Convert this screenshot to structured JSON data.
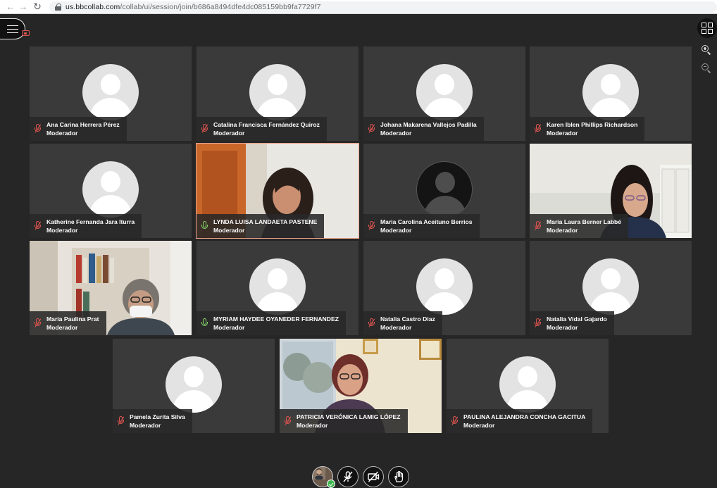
{
  "browser": {
    "url_host": "us.bbcollab.com",
    "url_path": "/collab/ui/session/join/b686a8494dfe4dc085159bb9fa7729f7"
  },
  "tiles": [
    {
      "name": "Ana Carina Herrera Pérez",
      "role": "Moderador",
      "mic": "muted",
      "media": "avatar"
    },
    {
      "name": "Catalina Francisca Fernández Quiroz",
      "role": "Moderador",
      "mic": "muted",
      "media": "avatar"
    },
    {
      "name": "Johana Makarena Vallejos Padilla",
      "role": "Moderador",
      "mic": "muted",
      "media": "avatar"
    },
    {
      "name": "Karen Iblen Phillips Richardson",
      "role": "Moderador",
      "mic": "muted",
      "media": "avatar"
    },
    {
      "name": "Katherine Fernanda Jara Iturra",
      "role": "Moderador",
      "mic": "muted",
      "media": "avatar"
    },
    {
      "name": "LYNDA LUISA LANDAETA PASTENE",
      "role": "Moderador",
      "mic": "on",
      "media": "video",
      "speaking": true
    },
    {
      "name": "Maria Carolina Aceituno Berrios",
      "role": "Moderador",
      "mic": "muted",
      "media": "avatar-dark"
    },
    {
      "name": "Maria Laura Berner Labbé",
      "role": "Moderador",
      "mic": "muted",
      "media": "video"
    },
    {
      "name": "Maria Paulina Prat",
      "role": "Moderador",
      "mic": "muted",
      "media": "video"
    },
    {
      "name": "MYRIAM HAYDEE OYANEDER FERNANDEZ",
      "role": "Moderador",
      "mic": "on",
      "media": "avatar"
    },
    {
      "name": "Natalia Castro Diaz",
      "role": "Moderador",
      "mic": "muted",
      "media": "avatar"
    },
    {
      "name": "Natalia Vidal Gajardo",
      "role": "Moderador",
      "mic": "muted",
      "media": "avatar"
    },
    {
      "name": "Pamela Zurita Silva",
      "role": "Moderador",
      "mic": "muted",
      "media": "avatar"
    },
    {
      "name": "PATRICIA VERÓNICA LAMIG LÓPEZ",
      "role": "Moderador",
      "mic": "muted",
      "media": "video"
    },
    {
      "name": "PAULINA ALEJANDRA CONCHA GACITUA",
      "role": "Moderador",
      "mic": "muted",
      "media": "avatar"
    }
  ],
  "colors": {
    "muted_mic": "#e0544f",
    "active_mic": "#88d66c",
    "speaking_border": "#e9a189",
    "status_ok": "#39b54a"
  },
  "icons": {
    "menu": "hamburger-icon",
    "recording": "recording-icon",
    "grid_view": "grid-icon",
    "zoom_in": "zoom-in-icon",
    "zoom_out": "zoom-out-icon",
    "mic_off": "mic-off-icon",
    "camera_off": "camera-off-icon",
    "raise_hand": "raise-hand-icon"
  }
}
